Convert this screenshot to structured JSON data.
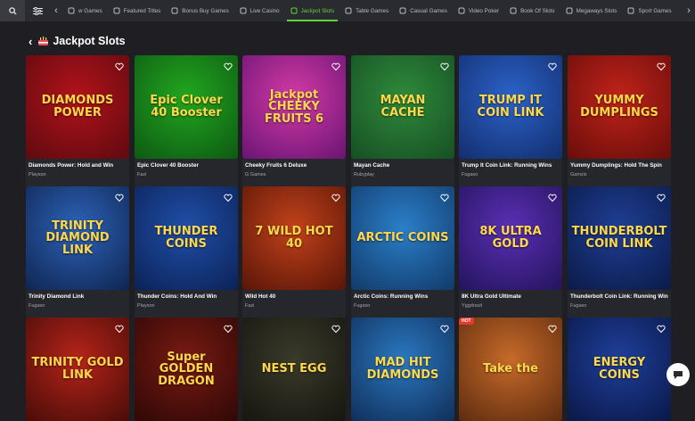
{
  "nav": {
    "tabs": [
      {
        "label": "w Games",
        "icon": "games-icon",
        "active": false
      },
      {
        "label": "Featured Titles",
        "icon": "star-icon",
        "active": false
      },
      {
        "label": "Bonus Buy Games",
        "icon": "gift-icon",
        "active": false
      },
      {
        "label": "Live Casino",
        "icon": "chip-icon",
        "active": false
      },
      {
        "label": "Jackpot Slots",
        "icon": "diamond-icon",
        "active": true
      },
      {
        "label": "Table Games",
        "icon": "cards-icon",
        "active": false
      },
      {
        "label": "Casual Games",
        "icon": "gamepad-icon",
        "active": false
      },
      {
        "label": "Video Poker",
        "icon": "poker-icon",
        "active": false
      },
      {
        "label": "Book Of Slots",
        "icon": "book-icon",
        "active": false
      },
      {
        "label": "Megaways Slots",
        "icon": "slot-icon",
        "active": false
      },
      {
        "label": "Sport Games",
        "icon": "ball-icon",
        "active": false
      }
    ],
    "accent": "#5fd23c"
  },
  "page": {
    "title": "Jackpot Slots",
    "title_icon": "jackpot-cake-icon"
  },
  "games": [
    {
      "name": "Diamonds Power: Hold and Win",
      "provider": "Playson",
      "art": "DIAMONDS POWER",
      "bg": "#b3121a",
      "bg2": "#5e0a10",
      "hot": false
    },
    {
      "name": "Epic Clover 40 Booster",
      "provider": "Fazi",
      "art": "Epic Clover 40 Booster",
      "bg": "#22a61f",
      "bg2": "#0d5a12",
      "hot": false
    },
    {
      "name": "Cheeky Fruits 6 Deluxe",
      "provider": "G Games",
      "art": "Jackpot CHEEKY FRUITS 6",
      "bg": "#d33aa5",
      "bg2": "#6a1474",
      "hot": false
    },
    {
      "name": "Mayan Cache",
      "provider": "Rubyplay",
      "art": "MAYAN CACHE",
      "bg": "#2e8a3a",
      "bg2": "#174f24",
      "hot": false
    },
    {
      "name": "Trump It Coin Link: Running Wins",
      "provider": "Fugaso",
      "art": "TRUMP IT COIN LINK",
      "bg": "#2b63c9",
      "bg2": "#132e6e",
      "hot": false
    },
    {
      "name": "Yummy Dumplings: Hold The Spin",
      "provider": "Gamzix",
      "art": "YUMMY DUMPLINGS",
      "bg": "#c0231a",
      "bg2": "#6a0d0a",
      "hot": false
    },
    {
      "name": "Trinity Diamond Link",
      "provider": "Fugaso",
      "art": "TRINITY DIAMOND LINK",
      "bg": "#2d63b8",
      "bg2": "#0f2552",
      "hot": false
    },
    {
      "name": "Thunder Coins: Hold And Win",
      "provider": "Playson",
      "art": "THUNDER COINS",
      "bg": "#1f4fa8",
      "bg2": "#0c2258",
      "hot": false
    },
    {
      "name": "Wild Hot 40",
      "provider": "Fazi",
      "art": "7 WILD HOT 40",
      "bg": "#c1421a",
      "bg2": "#5a1508",
      "hot": false
    },
    {
      "name": "Arctic Coins: Running Wins",
      "provider": "Fugaso",
      "art": "ARCTIC COINS",
      "bg": "#2a7fc9",
      "bg2": "#123a6a",
      "hot": false
    },
    {
      "name": "8K Ultra Gold Ultimate",
      "provider": "Yggdrasil",
      "art": "8K ULTRA GOLD",
      "bg": "#5a2fb5",
      "bg2": "#24145c",
      "hot": false
    },
    {
      "name": "Thunderbolt Coin Link: Running Wins",
      "provider": "Fugaso",
      "art": "THUNDERBOLT COIN LINK",
      "bg": "#1f3f95",
      "bg2": "#0b1a48",
      "hot": false
    },
    {
      "name": "",
      "provider": "",
      "art": "TRINITY GOLD LINK",
      "bg": "#b5241a",
      "bg2": "#4a0c08",
      "hot": false
    },
    {
      "name": "",
      "provider": "",
      "art": "Super GOLDEN DRAGON",
      "bg": "#7a1a12",
      "bg2": "#2e0806",
      "hot": false
    },
    {
      "name": "",
      "provider": "",
      "art": "NEST EGG",
      "bg": "#3a3a2a",
      "bg2": "#161610",
      "hot": false
    },
    {
      "name": "",
      "provider": "",
      "art": "MAD HIT DIAMONDS",
      "bg": "#2a78c0",
      "bg2": "#102f5a",
      "hot": false
    },
    {
      "name": "",
      "provider": "",
      "art": "Take the",
      "bg": "#c76a2a",
      "bg2": "#5e2c0e",
      "hot": true,
      "hot_label": "HOT"
    },
    {
      "name": "",
      "provider": "",
      "art": "ENERGY COINS",
      "bg": "#1f3f9a",
      "bg2": "#0a1848",
      "hot": false
    }
  ]
}
